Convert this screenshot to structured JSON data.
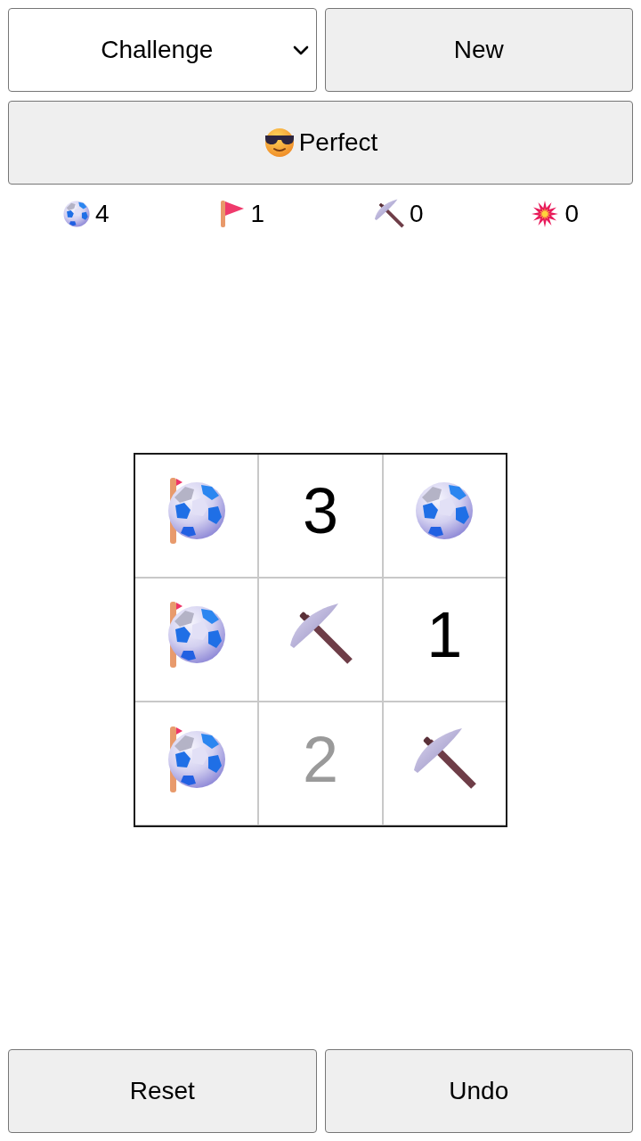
{
  "mode_select": {
    "value": "Challenge"
  },
  "new_button": {
    "label": "New"
  },
  "status_button": {
    "label": "Perfect"
  },
  "counters": [
    {
      "kind": "ball",
      "value": "4"
    },
    {
      "kind": "flag",
      "value": "1"
    },
    {
      "kind": "pickaxe",
      "value": "0"
    },
    {
      "kind": "explosion",
      "value": "0"
    }
  ],
  "board": {
    "rows": [
      [
        {
          "kind": "ball",
          "flagged": true
        },
        {
          "kind": "number",
          "text": "3",
          "dimmed": false
        },
        {
          "kind": "ball",
          "flagged": false
        }
      ],
      [
        {
          "kind": "ball",
          "flagged": true
        },
        {
          "kind": "pickaxe"
        },
        {
          "kind": "number",
          "text": "1",
          "dimmed": false
        }
      ],
      [
        {
          "kind": "ball",
          "flagged": true
        },
        {
          "kind": "number",
          "text": "2",
          "dimmed": true
        },
        {
          "kind": "pickaxe"
        }
      ]
    ]
  },
  "bottom_buttons": [
    {
      "label": "Reset"
    },
    {
      "label": "Undo"
    }
  ]
}
